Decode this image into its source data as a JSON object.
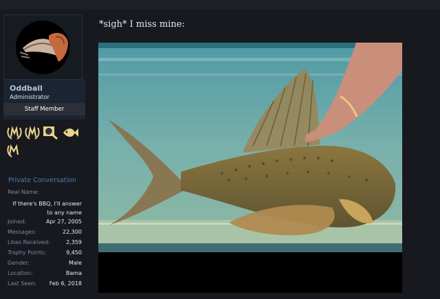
{
  "user": {
    "username": "Oddball",
    "user_title": "Administrator",
    "banner": "Staff Member",
    "private_conversation": "Private Conversation",
    "stats": [
      {
        "label": "Real Name:",
        "value": "If there's BBQ, I'll answer to any name"
      },
      {
        "label": "Joined:",
        "value": "Apr 27, 2005"
      },
      {
        "label": "Messages:",
        "value": "22,300"
      },
      {
        "label": "Likes Received:",
        "value": "2,359"
      },
      {
        "label": "Trophy Points:",
        "value": "9,450"
      },
      {
        "label": "Gender:",
        "value": "Male"
      },
      {
        "label": "Location:",
        "value": "Bama"
      },
      {
        "label": "Last Seen:",
        "value": "Feb 6, 2018"
      }
    ]
  },
  "post": {
    "message": "*sigh* I miss mine:"
  },
  "colors": {
    "accent": "#4f7bb0",
    "page_bg": "#17191f",
    "trophy_gold": "#e9d38a"
  }
}
